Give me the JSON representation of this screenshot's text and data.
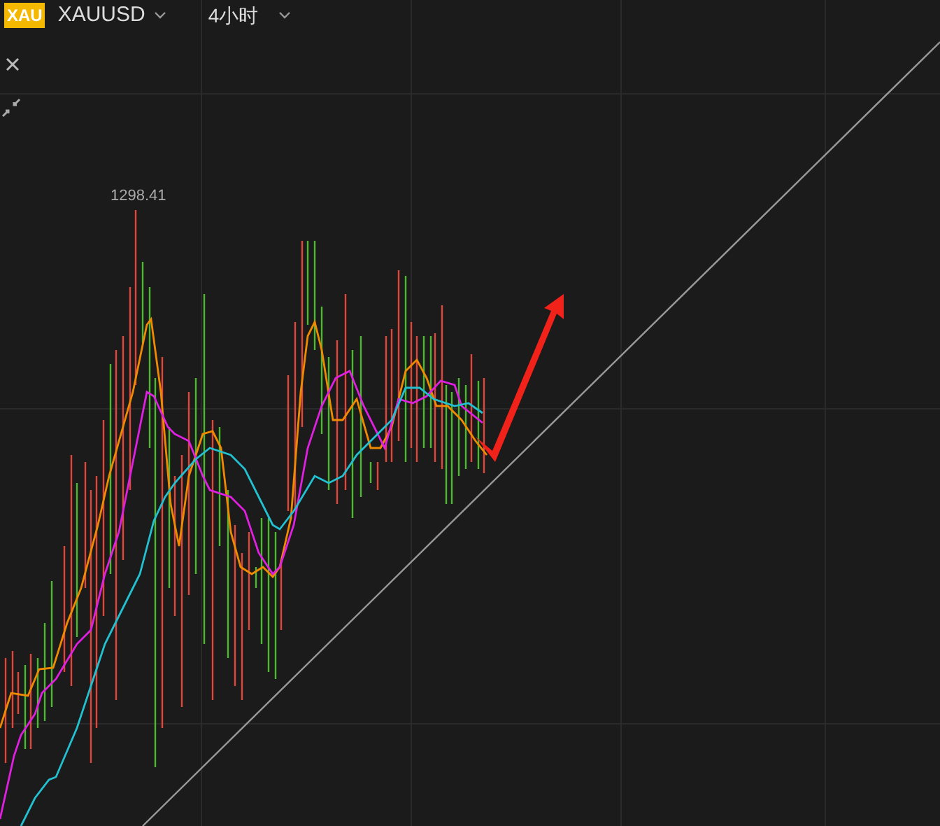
{
  "toolbar": {
    "symbol_badge": "XAU",
    "symbol": "XAUUSD",
    "timeframe": "4小时"
  },
  "chart": {
    "high_label": "1298.41"
  }
}
